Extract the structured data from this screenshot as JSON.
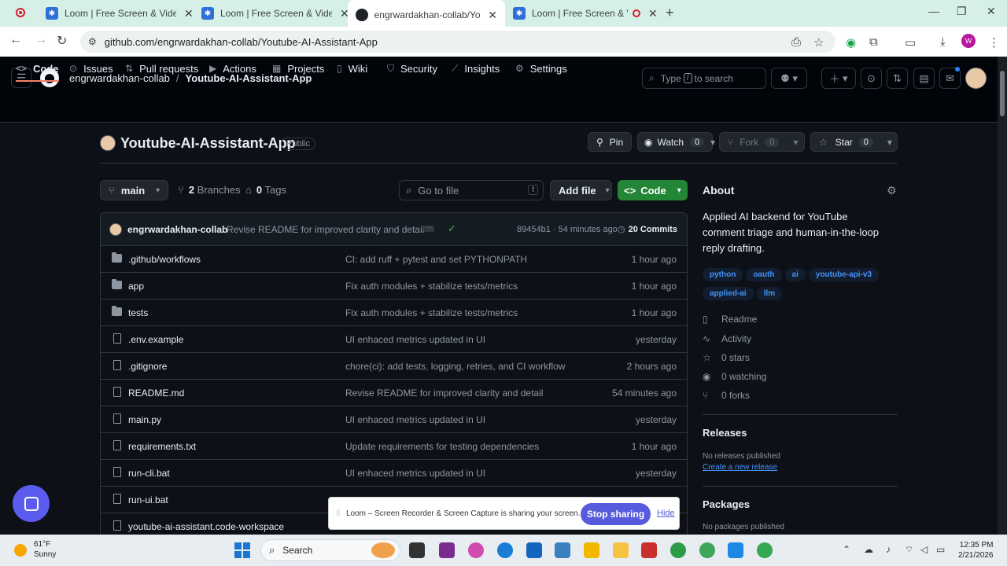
{
  "browser": {
    "tabs": [
      {
        "title": "Loom | Free Screen & Video Re",
        "icon": "loom-icon"
      },
      {
        "title": "Loom | Free Screen & Video Re",
        "icon": "loom-icon"
      },
      {
        "title": "engrwardakhan-collab/Youtube",
        "icon": "github-icon",
        "active": true
      },
      {
        "title": "Loom | Free Screen & Video",
        "icon": "loom-icon"
      }
    ],
    "url": "github.com/engrwardakhan-collab/Youtube-AI-Assistant-App",
    "profile_initial": "W"
  },
  "header": {
    "owner": "engrwardakhan-collab",
    "separator": "/",
    "repo": "Youtube-AI-Assistant-App",
    "search_prefix": "Type",
    "search_key": "/",
    "search_suffix": "to search"
  },
  "nav": [
    {
      "label": "Code",
      "icon": "code-icon"
    },
    {
      "label": "Issues",
      "icon": "issue-icon"
    },
    {
      "label": "Pull requests",
      "icon": "pull-request-icon"
    },
    {
      "label": "Actions",
      "icon": "actions-icon"
    },
    {
      "label": "Projects",
      "icon": "projects-icon"
    },
    {
      "label": "Wiki",
      "icon": "wiki-icon"
    },
    {
      "label": "Security",
      "icon": "shield-icon"
    },
    {
      "label": "Insights",
      "icon": "graph-icon"
    },
    {
      "label": "Settings",
      "icon": "gear-icon"
    }
  ],
  "repo": {
    "name": "Youtube-AI-Assistant-App",
    "visibility": "Public",
    "pin_label": "Pin",
    "watch_label": "Watch",
    "watch_count": "0",
    "fork_label": "Fork",
    "fork_count": "0",
    "star_label": "Star",
    "star_count": "0",
    "branch": "main",
    "branches_count": "2",
    "branches_label": "Branches",
    "tags_count": "0",
    "tags_label": "Tags",
    "goto_placeholder": "Go to file",
    "goto_key": "t",
    "add_file_label": "Add file",
    "code_label": "Code"
  },
  "latest_commit": {
    "author": "engrwardakhan-collab",
    "message": "Revise README for improved clarity and detail",
    "hash_time": "89454b1 · 54 minutes ago",
    "commits": "20 Commits"
  },
  "files": [
    {
      "name": ".github/workflows",
      "type": "dir",
      "message": "CI: add ruff + pytest and set PYTHONPATH",
      "date": "1 hour ago"
    },
    {
      "name": "app",
      "type": "dir",
      "message": "Fix auth modules + stabilize tests/metrics",
      "date": "1 hour ago"
    },
    {
      "name": "tests",
      "type": "dir",
      "message": "Fix auth modules + stabilize tests/metrics",
      "date": "1 hour ago"
    },
    {
      "name": ".env.example",
      "type": "file",
      "message": "UI enhaced metrics updated in UI",
      "date": "yesterday"
    },
    {
      "name": ".gitignore",
      "type": "file",
      "message": "chore(ci): add tests, logging, retries, and CI workflow",
      "date": "2 hours ago"
    },
    {
      "name": "README.md",
      "type": "file",
      "message": "Revise README for improved clarity and detail",
      "date": "54 minutes ago"
    },
    {
      "name": "main.py",
      "type": "file",
      "message": "UI enhaced metrics updated in UI",
      "date": "yesterday"
    },
    {
      "name": "requirements.txt",
      "type": "file",
      "message": "Update requirements for testing dependencies",
      "date": "1 hour ago"
    },
    {
      "name": "run-cli.bat",
      "type": "file",
      "message": "UI enhaced metrics updated in UI",
      "date": "yesterday"
    },
    {
      "name": "run-ui.bat",
      "type": "file",
      "message": "",
      "date": ""
    },
    {
      "name": "youtube-ai-assistant.code-workspace",
      "type": "file",
      "message": "",
      "date": ""
    }
  ],
  "about": {
    "title": "About",
    "description": "Applied AI backend for YouTube comment triage and human-in-the-loop reply drafting.",
    "topics": [
      "python",
      "oauth",
      "ai",
      "youtube-api-v3",
      "applied-ai",
      "llm"
    ],
    "stats": [
      {
        "label": "Readme",
        "icon": "book-icon"
      },
      {
        "label": "Activity",
        "icon": "pulse-icon"
      },
      {
        "label": "0 stars",
        "icon": "star-icon"
      },
      {
        "label": "0 watching",
        "icon": "eye-icon"
      },
      {
        "label": "0 forks",
        "icon": "fork-icon"
      }
    ]
  },
  "releases": {
    "title": "Releases",
    "empty": "No releases published",
    "link": "Create a new release"
  },
  "packages": {
    "title": "Packages",
    "empty": "No packages published"
  },
  "loom": {
    "message": "Loom – Screen Recorder & Screen Capture is sharing your screen.",
    "stop_label": "Stop sharing",
    "hide_label": "Hide"
  },
  "taskbar": {
    "temp": "61°F",
    "weather": "Sunny",
    "search": "Search",
    "time": "12:35 PM",
    "date": "2/21/2026"
  }
}
